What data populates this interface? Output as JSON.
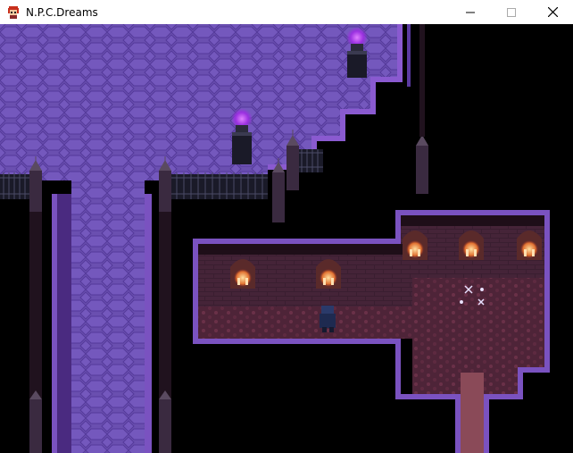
{
  "window": {
    "title": "N.P.C.Dreams",
    "icon": "red-haired-character-icon",
    "controls": [
      "minimize-icon",
      "maximize-icon",
      "close-icon"
    ]
  },
  "scene": {
    "description_free": true,
    "palette": {
      "floor_purple": "#6a4fb0",
      "wall_border": "#7a52c0",
      "brick_wall": "#3a1e30",
      "flame": "#b040ff",
      "candle": "#ffb070",
      "carpet": "#5a2a40",
      "void": "#000000"
    }
  }
}
